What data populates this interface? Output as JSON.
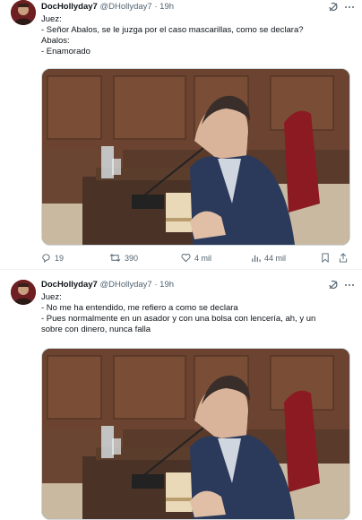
{
  "tweets": [
    {
      "display_name": "DocHollyday7",
      "handle": "@DHollyday7",
      "separator": "·",
      "time": "19h",
      "lines": [
        "Juez:",
        "- Señor Abalos, se le juzga por el caso mascarillas, como se declara?",
        "Abalos:",
        "- Enamorado"
      ],
      "actions": {
        "replies": "19",
        "reposts": "390",
        "likes": "4 mil",
        "views": "44 mil"
      }
    },
    {
      "display_name": "DocHollyday7",
      "handle": "@DHollyday7",
      "separator": "·",
      "time": "19h",
      "lines": [
        "Juez:",
        "- No me ha entendido, me refiero a como se declara",
        "- Pues normalmente en un asador y con una bolsa con lencería, ah, y un",
        "sobre con dinero, nunca falla"
      ]
    }
  ],
  "icons": {
    "more": "more-icon",
    "grok": "grok-icon",
    "reply": "reply-icon",
    "repost": "repost-icon",
    "like": "like-icon",
    "views": "views-icon",
    "bookmark": "bookmark-icon",
    "share": "share-icon"
  },
  "colors": {
    "text": "#0f1419",
    "secondary": "#536471",
    "border": "#cfd9de"
  }
}
